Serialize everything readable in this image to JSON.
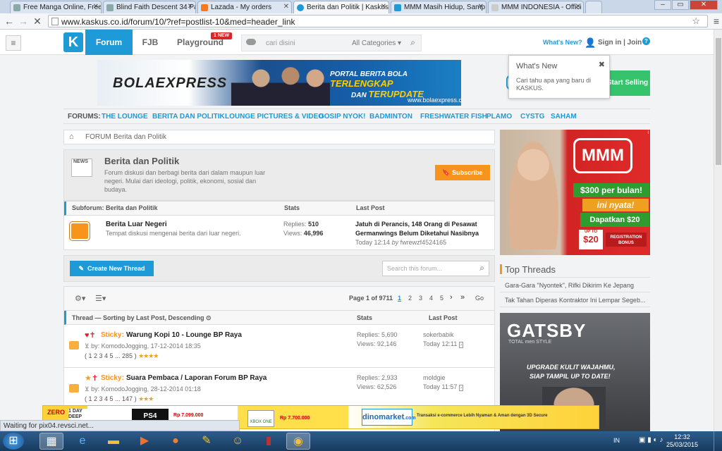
{
  "browser": {
    "tabs": [
      {
        "title": "Free Manga Online, Free M"
      },
      {
        "title": "Blind Faith Descent 34 Pa"
      },
      {
        "title": "Lazada - My orders"
      },
      {
        "title": "Berita dan Politik | Kaskus"
      },
      {
        "title": "MMM Masih Hidup, Samp"
      },
      {
        "title": "MMM INDONESIA - Offici"
      }
    ],
    "url": "www.kaskus.co.id/forum/10/?ref=postlist-10&med=header_link",
    "status": "Waiting for pix04.revsci.net..."
  },
  "header": {
    "nav": [
      "Forum",
      "FJB",
      "Playground"
    ],
    "new_badge": "1 NEW",
    "search_placeholder": "cari disini",
    "category": "All Categories",
    "whats_new": "What's New?",
    "signin": "Sign in | Join"
  },
  "popup": {
    "title": "What's New",
    "text": "Cari tahu apa yang baru di KASKUS."
  },
  "banner": {
    "brand": "BOLAEXPRESS",
    "tag_prefix": "PORTAL BERITA BOLA",
    "tag_a": "TERLENGKAP",
    "tag_mid": "DAN",
    "tag_b": "TERUPDATE",
    "site": "www.bolaexpress.com",
    "sell": "Start Selling"
  },
  "forums_bar": {
    "label": "FORUMS:",
    "items": [
      "THE LOUNGE",
      "BERITA DAN POLITIK",
      "LOUNGE PICTURES & VIDEO",
      "GOSIP NYOK!",
      "BADMINTON",
      "FRESHWATER FISH",
      "PLAMO",
      "CYSTG",
      "SAHAM"
    ]
  },
  "breadcrumb": {
    "forum": "FORUM",
    "current": "Berita dan Politik"
  },
  "forum_info": {
    "news_icon_label": "NEWS",
    "title": "Berita dan Politik",
    "desc": "Forum diskusi dan berbagi berita dari dalam maupun luar negeri. Mulai dari ideologi, politik, ekonomi, sosial dan budaya.",
    "subscribe": "Subscribe"
  },
  "subforum": {
    "header": "Subforum: Berita dan Politik",
    "stats_header": "Stats",
    "last_header": "Last Post",
    "name": "Berita Luar Negeri",
    "desc": "Tempat diskusi mengenai berita dari luar negeri.",
    "replies_label": "Replies:",
    "replies": "510",
    "views_label": "Views:",
    "views": "46,996",
    "last_title_1": "Jatuh di Perancis, 148 Orang di Pesawat",
    "last_title_2": "Germanwings Belum Diketahui Nasibnya",
    "last_meta": "Today 12:14",
    "last_by": "by",
    "last_user": "fwrewzf4524165"
  },
  "create_thread": "Create New Thread",
  "search_forum_placeholder": "Search this forum...",
  "pagination": {
    "label": "Page 1 of 9711",
    "pages": [
      "1",
      "2",
      "3",
      "4",
      "5"
    ],
    "go": "Go"
  },
  "thread_list": {
    "header": "Thread — Sorting by Last Post, Descending",
    "stats": "Stats",
    "last": "Last Post",
    "threads": [
      {
        "sticky": "Sticky:",
        "title": "Warung Kopi 10 - Lounge BP Raya",
        "by": "by:",
        "author": "KomodoJogging, 17-12-2014 18:35",
        "pages": "1 2 3 4 5 ... 285",
        "replies": "Replies: 5,690",
        "views": "Views: 92,146",
        "last_user": "sokerbabik",
        "last_time": "Today 12:11"
      },
      {
        "sticky": "Sticky:",
        "title": "Suara Pembaca / Laporan Forum BP Raya",
        "by": "by:",
        "author": "KomodoJogging, 28-12-2014 01:18",
        "pages": "1 2 3 4 5 ... 147",
        "replies": "Replies: 2,933",
        "views": "Views: 62,526",
        "last_user": "moldgie",
        "last_time": "Today 11:57"
      }
    ]
  },
  "sidebar": {
    "mmm": {
      "brand": "MMM",
      "line1": "$300 per bulan!",
      "line2": "ini nyata!",
      "line3": "Dapatkan $20",
      "line4": "UP TO",
      "line5": "$20",
      "line6": "REGISTRATION BONUS"
    },
    "top_threads_title": "Top Threads",
    "top_threads": [
      "Gara-Gara \"Nyontek\", Rifki Dikirim Ke Jepang",
      "Tak Tahan Diperas Kontraktor Ini Lempar Segeb..."
    ],
    "gatsby": {
      "brand": "GATSBY",
      "sub": "TOTAL men STYLE",
      "line1": "UPGRADE KULIT WAJAHMU,",
      "line2": "SIAP TAMPIL UP TO DATE!"
    }
  },
  "bottom_ad": {
    "zero": "ZERO",
    "day": "1 DAY DEEP",
    "ps4": "PS4",
    "price1": "Rp 7.099.000",
    "xbox": "XBOX ONE",
    "price2": "Rp 7.700.000",
    "dino": "dinomarket",
    "dino_sub": ".com",
    "tagline": "Transaksi e-commerce Lebih Nyaman & Aman dengan 3D Secure"
  },
  "taskbar": {
    "lang": "IN",
    "time": "12:32",
    "date": "25/03/2015"
  },
  "colors": {
    "brand_blue": "#1e9bd7",
    "orange": "#f7941d",
    "green": "#35c36b"
  }
}
